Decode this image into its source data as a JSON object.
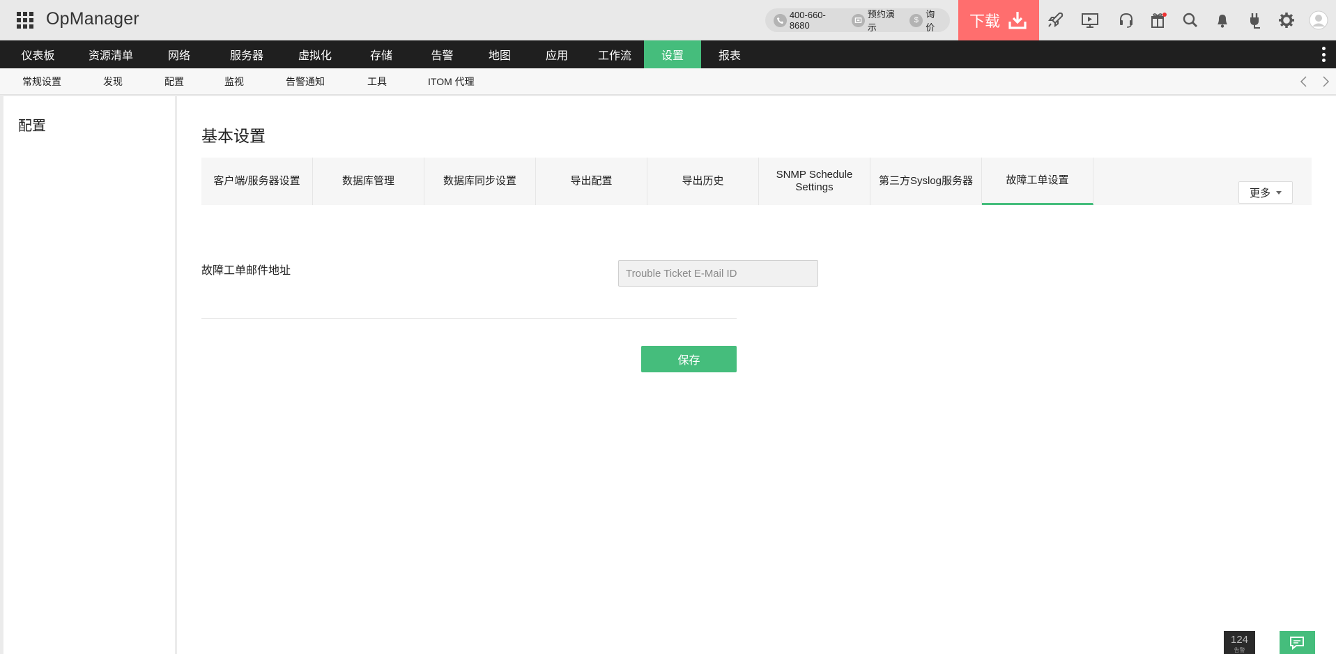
{
  "header": {
    "brand": "OpManager",
    "phone": "400-660-8680",
    "demo_label": "预约演示",
    "price_label": "询价",
    "price_icon": "$",
    "download_label": "下载"
  },
  "main_nav": [
    {
      "label": "仪表板",
      "active": false
    },
    {
      "label": "资源清单",
      "active": false
    },
    {
      "label": "网络",
      "active": false
    },
    {
      "label": "服务器",
      "active": false
    },
    {
      "label": "虚拟化",
      "active": false
    },
    {
      "label": "存储",
      "active": false
    },
    {
      "label": "告警",
      "active": false
    },
    {
      "label": "地图",
      "active": false
    },
    {
      "label": "应用",
      "active": false
    },
    {
      "label": "工作流",
      "active": false
    },
    {
      "label": "设置",
      "active": true
    },
    {
      "label": "报表",
      "active": false
    }
  ],
  "sub_nav": [
    {
      "label": "常规设置"
    },
    {
      "label": "发现"
    },
    {
      "label": "配置"
    },
    {
      "label": "监视"
    },
    {
      "label": "告警通知"
    },
    {
      "label": "工具"
    },
    {
      "label": "ITOM 代理"
    }
  ],
  "sidebar": {
    "title": "配置"
  },
  "page": {
    "title": "基本设置",
    "tabs": [
      {
        "label": "客户端/服务器设置",
        "active": false
      },
      {
        "label": "数据库管理",
        "active": false
      },
      {
        "label": "数据库同步设置",
        "active": false
      },
      {
        "label": "导出配置",
        "active": false
      },
      {
        "label": "导出历史",
        "active": false
      },
      {
        "label": "SNMP Schedule Settings",
        "active": false
      },
      {
        "label": "第三方Syslog服务器",
        "active": false
      },
      {
        "label": "故障工单设置",
        "active": true
      }
    ],
    "more_label": "更多"
  },
  "form": {
    "email_label": "故障工单邮件地址",
    "email_value": "",
    "email_placeholder": "Trouble Ticket E-Mail ID",
    "save_label": "保存"
  },
  "footer": {
    "alarm_count": "124",
    "alarm_label": "告警"
  },
  "colors": {
    "accent": "#45bd7c",
    "download": "#ff6e6e",
    "nav_bg": "#1f1f1f"
  },
  "icons": {
    "app_menu": "grid-icon",
    "toolbar": [
      "rocket-icon",
      "presentation-icon",
      "headset-icon",
      "gift-icon",
      "search-icon",
      "bell-icon",
      "plug-icon",
      "gear-icon",
      "user-avatar-icon"
    ]
  }
}
